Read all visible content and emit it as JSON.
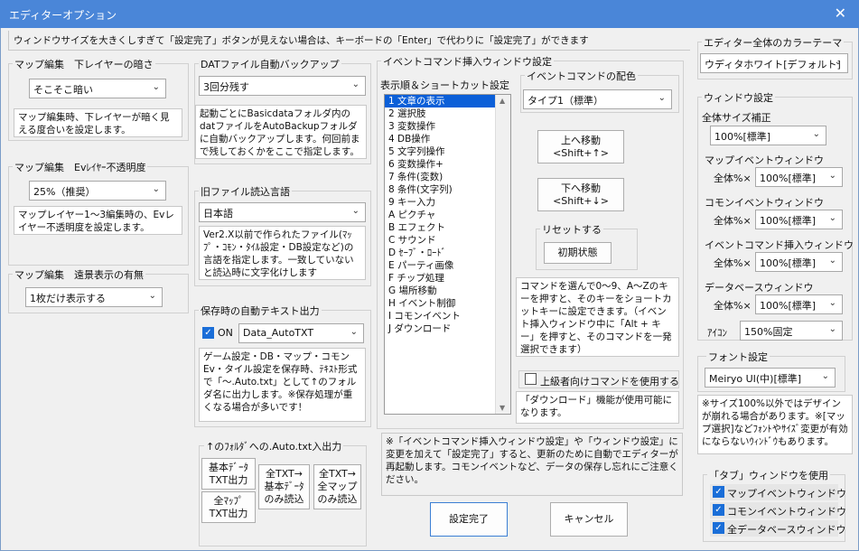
{
  "window": {
    "title": "エディターオプション",
    "close": "✕"
  },
  "notice": "ウィンドウサイズを大きくしすぎて「設定完了」ボタンが見えない場合は、キーボードの「Enter」で代わりに「設定完了」ができます",
  "map_darkness": {
    "label": "マップ編集　下レイヤーの暗さ",
    "value": "そこそこ暗い",
    "desc": "マップ編集時、下レイヤーが暗く見える度合いを設定します。"
  },
  "ev_opacity": {
    "label": "マップ編集　Evﾚｲﾔｰ不透明度",
    "value": "25%（推奨）",
    "desc": "マップレイヤー1～3編集時の、Evレイヤー不透明度を設定します。"
  },
  "distant_view": {
    "label": "マップ編集　遠景表示の有無",
    "value": "1枚だけ表示する"
  },
  "dat_backup": {
    "label": "DATファイル自動バックアップ",
    "value": "3回分残す",
    "desc": "起動ごとにBasicdataフォルダ内のdatファイルをAutoBackupフォルダに自動バックアップします。何回前まで残しておくかをここで指定します。"
  },
  "old_lang": {
    "label": "旧ファイル読込言語",
    "value": "日本語",
    "desc": "Ver2.X以前で作られたファイル(ﾏｯﾌﾟ・ｺﾓﾝ・ﾀｲﾙ設定・DB設定など)の言語を指定します。一致していないと読込時に文字化けします"
  },
  "auto_text": {
    "label": "保存時の自動テキスト出力",
    "on_label": "ON",
    "value": "Data_AutoTXT",
    "desc": "ゲーム設定・DB・マップ・コモンEv・タイル設定を保存時、ﾃｷｽﾄ形式で「～.Auto.txt」として↑のフォルダ名に出力します。※保存処理が重くなる場合が多いです！"
  },
  "auto_txt_in": {
    "label": "↑のﾌｫﾙﾀﾞへの.Auto.txt入出力",
    "btn_basic_out": [
      "基本ﾃﾞｰﾀ",
      "TXT出力"
    ],
    "btn_all_map_out": [
      "全ﾏｯﾌﾟ",
      "TXT出力"
    ],
    "btn_all_basic_in": [
      "全TXT→",
      "基本ﾃﾞｰﾀ",
      "のみ読込"
    ],
    "btn_all_map_in": [
      "全TXT→",
      "全マップ",
      "のみ読込"
    ]
  },
  "event_window": {
    "label": "イベントコマンド挿入ウィンドウ設定",
    "order_label": "表示順＆ショートカット設定",
    "items": [
      "1 文章の表示",
      "2 選択肢",
      "3 変数操作",
      "4 DB操作",
      "5 文字列操作",
      "6 変数操作+",
      "7 条件(変数)",
      "8 条件(文字列)",
      "9 キー入力",
      "A ピクチャ",
      "B エフェクト",
      "C サウンド",
      "D ｾｰﾌﾞ・ﾛｰﾄﾞ",
      "E パーティ画像",
      "F チップ処理",
      "G 場所移動",
      "H イベント制御",
      "I コモンイベント",
      "J ダウンロード"
    ],
    "color_label": "イベントコマンドの配色",
    "color_value": "タイプ1（標準）",
    "move_up": [
      "上へ移動",
      "<Shift+↑>"
    ],
    "move_down": [
      "下へ移動",
      "<Shift+↓>"
    ],
    "reset_label": "リセットする",
    "reset_btn": "初期状態",
    "shortcut_desc": "コマンドを選んで0～9、A～Zのキーを押すと、そのキーをショートカットキーに設定できます。（イベント挿入ウィンドウ中に「Alt + キー」を押すと、そのコマンドを一発選択できます）",
    "advanced_label": "上級者向けコマンドを使用する",
    "advanced_desc": "「ダウンロード」機能が使用可能になります。"
  },
  "restart_notice": "※「イベントコマンド挿入ウィンドウ設定」や「ウィンドウ設定」に変更を加えて「設定完了」すると、更新のために自動でエディターが再起動します。コモンイベントなど、データの保存し忘れにご注意ください。",
  "buttons": {
    "ok": "設定完了",
    "cancel": "キャンセル"
  },
  "theme": {
    "label": "エディター全体のカラーテーマ",
    "value": "ウディタホワイト[デフォルト]"
  },
  "window_settings": {
    "label": "ウィンドウ設定",
    "overall_label": "全体サイズ補正",
    "overall_value": "100%[標準]",
    "map_event_label": "マップイベントウィンドウ",
    "common_event_label": "コモンイベントウィンドウ",
    "event_insert_label": "イベントコマンド挿入ウィンドウ",
    "database_label": "データベースウィンドウ",
    "whole_pct": "全体%×",
    "map_event_value": "100%[標準]",
    "common_event_value": "100%[標準]",
    "event_insert_value": "100%[標準]",
    "database_value": "100%[標準]",
    "icon_label": "ｱｲｺﾝ",
    "icon_value": "150%固定"
  },
  "font": {
    "label": "フォント設定",
    "value": "Meiryo UI(中)[標準]",
    "desc": "※サイズ100%以外ではデザインが崩れる場合があります。※[マップ選択]などﾌｫﾝﾄやｻｲｽﾞ変更が有効にならないｳｨﾝﾄﾞｳもあります。"
  },
  "tab": {
    "label": "「タブ」ウィンドウを使用",
    "items": [
      "マップイベントウィンドウ",
      "コモンイベントウィンドウ",
      "全データベースウィンドウ"
    ]
  },
  "colors": {
    "titlebar": "#4a86d8",
    "accent": "#1a6ed8",
    "selection": "#0b5fd8"
  }
}
